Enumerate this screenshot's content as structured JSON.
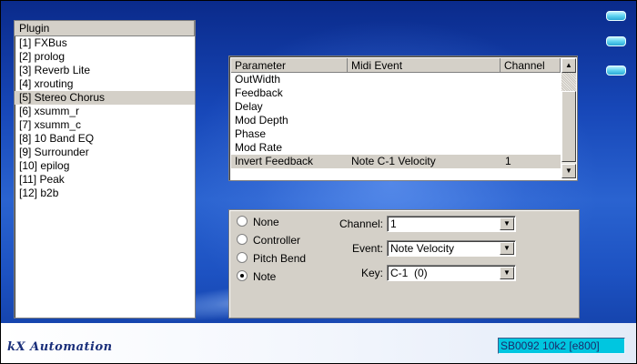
{
  "app": {
    "title": "kX Automation",
    "device_label": "SB0092 10k2 [e800]"
  },
  "plugin_list": {
    "header": "Plugin",
    "items": [
      "[1] FXBus",
      "[2] prolog",
      "[3] Reverb Lite",
      "[4] xrouting",
      "[5] Stereo Chorus",
      "[6] xsumm_r",
      "[7] xsumm_c",
      "[8] 10 Band EQ",
      "[9] Surrounder",
      "[10] epilog",
      "[11] Peak",
      "[12] b2b"
    ],
    "selected": "[5] Stereo Chorus"
  },
  "param_table": {
    "columns": [
      "Parameter",
      "Midi Event",
      "Channel"
    ],
    "rows": [
      {
        "parameter": "OutWidth",
        "midi_event": "",
        "channel": ""
      },
      {
        "parameter": "Feedback",
        "midi_event": "",
        "channel": ""
      },
      {
        "parameter": "Delay",
        "midi_event": "",
        "channel": ""
      },
      {
        "parameter": "Mod Depth",
        "midi_event": "",
        "channel": ""
      },
      {
        "parameter": "Phase",
        "midi_event": "",
        "channel": ""
      },
      {
        "parameter": "Mod Rate",
        "midi_event": "",
        "channel": ""
      },
      {
        "parameter": "Invert Feedback",
        "midi_event": "Note C-1 Velocity",
        "channel": "1"
      }
    ],
    "selected": "Invert Feedback"
  },
  "event_type": {
    "options": [
      "None",
      "Controller",
      "Pitch Bend",
      "Note"
    ],
    "selected": "Note"
  },
  "fields": {
    "channel": {
      "label": "Channel:",
      "value": "1"
    },
    "event": {
      "label": "Event:",
      "value": "Note Velocity"
    },
    "key": {
      "label": "Key:",
      "value": "C-1  (0)"
    }
  },
  "icons": {
    "scroll_up": "scroll-up-arrow-icon",
    "scroll_down": "scroll-down-arrow-icon",
    "dropdown": "chevron-down-icon",
    "window_buttons": [
      "minimize-icon",
      "maximize-icon",
      "close-icon"
    ]
  },
  "colors": {
    "background": "#1d52c2",
    "panel": "#d4d0c8",
    "device_box": "#00c6e0",
    "window_button": "#5ed3f0"
  }
}
